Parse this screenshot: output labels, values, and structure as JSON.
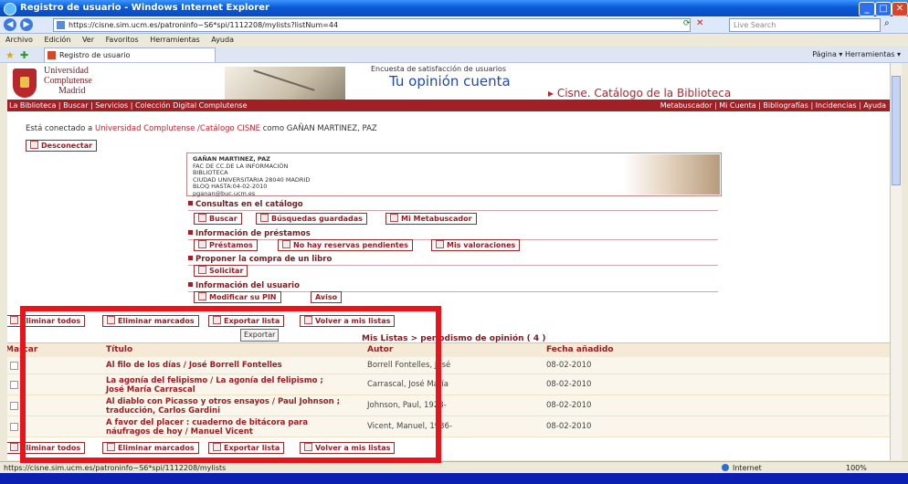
{
  "window": {
    "title": "Registro de usuario - Windows Internet Explorer",
    "min": "_",
    "max": "□",
    "close": "✕"
  },
  "address": {
    "url": "https://cisne.sim.ucm.es/patroninfo~S6*spi/1112208/mylists?listNum=44",
    "search_placeholder": "Live Search",
    "back": "◀",
    "forward": "▶"
  },
  "menu": [
    "Archivo",
    "Edición",
    "Ver",
    "Favoritos",
    "Herramientas",
    "Ayuda"
  ],
  "tabbar": {
    "tab_label": "Registro de usuario",
    "tools": "Página ▾   Herramientas ▾"
  },
  "header": {
    "uni1": "Universidad",
    "uni2": "Complutense",
    "uni3": "Madrid",
    "encuesta": "Encuesta de satisfacción de usuarios",
    "opinion": "Tu opinión cuenta",
    "catalog": "▸ Cisne. Catálogo de la Biblioteca"
  },
  "navbar": {
    "left": "La Biblioteca | Buscar | Servicios | Colección Digital Complutense",
    "right": "Metabuscador | Mi Cuenta | Bibliografías | Incidencias | Ayuda"
  },
  "session": {
    "p1": "Está conectado a ",
    "link1": "Universidad Complutense /Catálogo CISNE",
    "p2": " como GAÑAN MARTINEZ, PAZ",
    "logout": "Desconectar"
  },
  "user": {
    "name": "GAÑAN MARTINEZ, PAZ",
    "lines": [
      "FAC DE CC.DE LA INFORMACIÓN",
      "BIBLIOTECA",
      "CIUDAD UNIVERSITARIA 28040 MADRID",
      "BLOQ HASTA:04-02-2010",
      "pganan@buc.ucm.es"
    ]
  },
  "sections": {
    "consultas": {
      "title": "Consultas en el catálogo",
      "buttons": [
        "Buscar",
        "Búsquedas guardadas",
        "Mi Metabuscador"
      ]
    },
    "prestamos": {
      "title": "Información de préstamos",
      "buttons": [
        "Préstamos",
        "No hay reservas pendientes",
        "Mis valoraciones"
      ]
    },
    "compra": {
      "title": "Proponer la compra de un libro",
      "buttons": [
        "Solicitar"
      ]
    },
    "usuario": {
      "title": "Información del usuario",
      "buttons": [
        "Modificar su PIN",
        "Aviso"
      ]
    }
  },
  "list_actions": [
    "Eliminar todos",
    "Eliminar marcados",
    "Exportar lista",
    "Volver a mis listas"
  ],
  "export_label": "Exportar",
  "list_title": "Mis Listas > periodismo de opinión ( 4 )",
  "table": {
    "headers": [
      "Marcar",
      "Título",
      "Autor",
      "Fecha añadido"
    ],
    "rows": [
      {
        "title1": "Al filo de los días / José Borrell Fontelles",
        "title2": "",
        "autor": "Borrell Fontelles, José",
        "fecha": "08-02-2010"
      },
      {
        "title1": "La agonía del felipismo / La agonía del felipismo ;",
        "title2": "José María Carrascal",
        "autor": "Carrascal, José María",
        "fecha": "08-02-2010"
      },
      {
        "title1": "Al diablo con Picasso y otros ensayos / Paul Johnson ;",
        "title2": "traducción, Carlos Gardini",
        "autor": "Johnson, Paul, 1928-",
        "fecha": "08-02-2010"
      },
      {
        "title1": "A favor del placer : cuaderno de bitácora para",
        "title2": "náufragos de hoy / Manuel Vicent",
        "autor": "Vicent, Manuel, 1936-",
        "fecha": "08-02-2010"
      }
    ]
  },
  "status": {
    "url": "https://cisne.sim.ucm.es/patroninfo~S6*spi/1112208/mylists",
    "zone": "Internet",
    "zoom": "100%"
  },
  "colors": {
    "brand_red": "#a02026",
    "highlight": "#e8131b",
    "desktop_blue": "#0b1fb0"
  }
}
